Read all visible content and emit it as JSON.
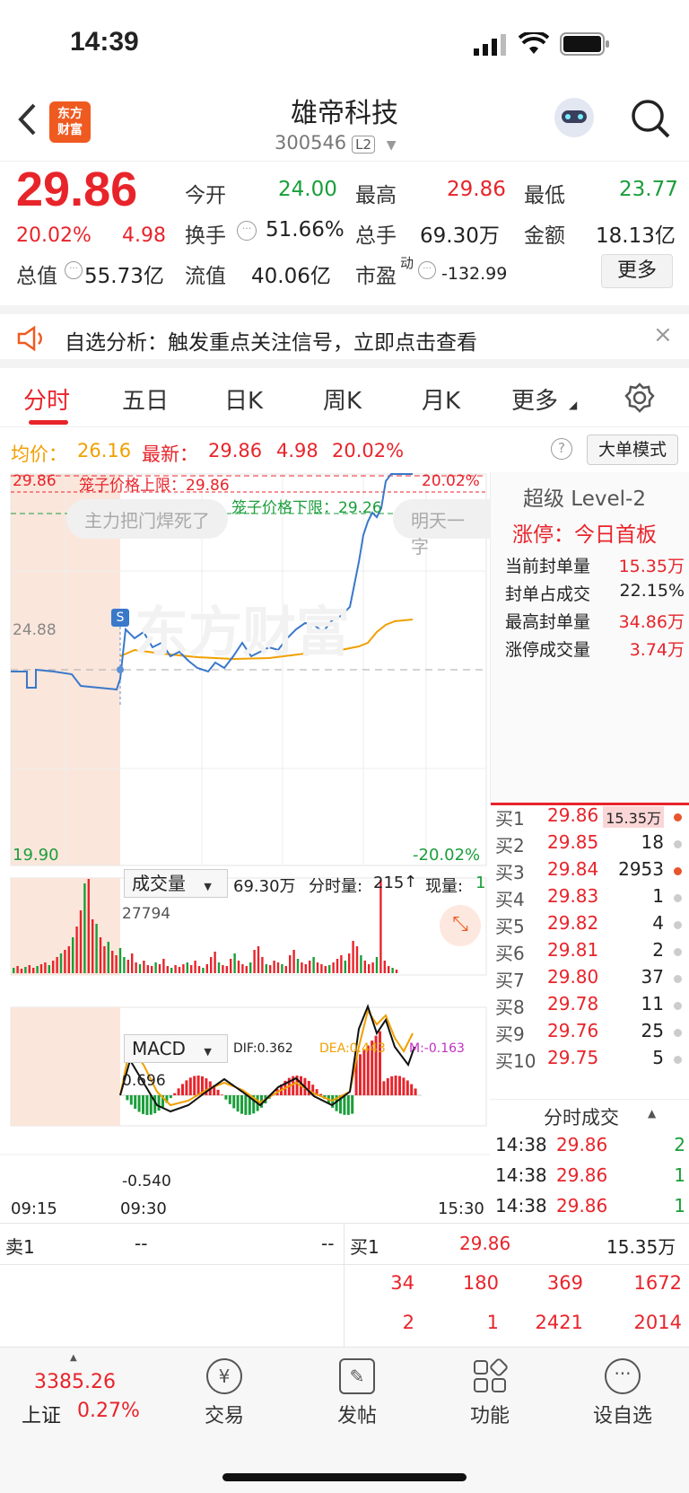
{
  "status_bar": {
    "time": "14:39"
  },
  "header": {
    "logo_line1": "东方",
    "logo_line2": "财富",
    "title": "雄帝科技",
    "code": "300546",
    "level": "L2"
  },
  "quote": {
    "price": "29.86",
    "pct": "20.02%",
    "change": "4.98",
    "open_label": "今开",
    "open": "24.00",
    "high_label": "最高",
    "high": "29.86",
    "low_label": "最低",
    "low": "23.77",
    "turnover_label": "换手",
    "turnover": "51.66%",
    "volume_label": "总手",
    "volume": "69.30万",
    "amount_label": "金额",
    "amount": "18.13亿",
    "mktcap_label": "总值",
    "mktcap": "55.73亿",
    "float_label": "流值",
    "float": "40.06亿",
    "pe_label": "市盈",
    "pe_sup": "动",
    "pe": "-132.99",
    "more_button": "更多"
  },
  "notice": {
    "text": "自选分析：触发重点关注信号，立即点击查看"
  },
  "tabs": [
    "分时",
    "五日",
    "日K",
    "周K",
    "月K",
    "更多"
  ],
  "chart_header": {
    "avg_label": "均价：",
    "avg": "26.16",
    "latest_label": "最新：",
    "latest": "29.86",
    "chg": "4.98",
    "pct": "20.02%",
    "mode_button": "大单模式"
  },
  "chart_labels": {
    "top_price": "29.86",
    "top_pct": "20.02%",
    "upper_cage": "笼子价格上限：29.86",
    "lower_cage": "笼子价格下限：29.26",
    "bottom_price": "19.90",
    "bottom_pct": "-20.02%",
    "mid_price": "24.88",
    "s_marker": "S",
    "bubble1": "主力把门焊死了",
    "bubble2": "明天一字",
    "watermark": "东方财富"
  },
  "volume_header": {
    "select": "成交量",
    "total": "69.30万",
    "minute_label": "分时量:",
    "minute": "215",
    "now_label": "现量:",
    "now": "1",
    "max": "27794"
  },
  "macd_header": {
    "select": "MACD",
    "dif": "DIF:0.362",
    "dea": "DEA:0.443",
    "m": "M:-0.163",
    "top": "0.696",
    "bottom": "-0.540"
  },
  "time_axis": [
    "09:15",
    "09:30",
    "15:30"
  ],
  "level2": {
    "title": "超级 Level-2",
    "limit_status": "涨停：今日首板",
    "rows": [
      {
        "label": "当前封单量",
        "value": "15.35万"
      },
      {
        "label": "封单占成交",
        "value": "22.15%"
      },
      {
        "label": "最高封单量",
        "value": "34.86万"
      },
      {
        "label": "涨停成交量",
        "value": "3.74万"
      }
    ]
  },
  "orderbook": [
    {
      "label": "买1",
      "price": "29.86",
      "vol": "15.35万",
      "dot": "#e8542b"
    },
    {
      "label": "买2",
      "price": "29.85",
      "vol": "18",
      "dot": "#cccccc"
    },
    {
      "label": "买3",
      "price": "29.84",
      "vol": "2953",
      "dot": "#e8542b"
    },
    {
      "label": "买4",
      "price": "29.83",
      "vol": "1",
      "dot": "#cccccc"
    },
    {
      "label": "买5",
      "price": "29.82",
      "vol": "4",
      "dot": "#cccccc"
    },
    {
      "label": "买6",
      "price": "29.81",
      "vol": "2",
      "dot": "#cccccc"
    },
    {
      "label": "买7",
      "price": "29.80",
      "vol": "37",
      "dot": "#cccccc"
    },
    {
      "label": "买8",
      "price": "29.78",
      "vol": "11",
      "dot": "#cccccc"
    },
    {
      "label": "买9",
      "price": "29.76",
      "vol": "25",
      "dot": "#cccccc"
    },
    {
      "label": "买10",
      "price": "29.75",
      "vol": "5",
      "dot": "#cccccc"
    }
  ],
  "ticks": {
    "title": "分时成交",
    "rows": [
      {
        "time": "14:38",
        "price": "29.86",
        "vol": "2"
      },
      {
        "time": "14:38",
        "price": "29.86",
        "vol": "1"
      },
      {
        "time": "14:38",
        "price": "29.86",
        "vol": "1"
      }
    ]
  },
  "bottom_book": {
    "sell_label": "卖1",
    "sell_price": "--",
    "sell_vol": "--",
    "buy_label": "买1",
    "buy_price": "29.86",
    "buy_vol": "15.35万",
    "row1": [
      "34",
      "180",
      "369",
      "1672"
    ],
    "row2": [
      "2",
      "1",
      "2421",
      "2014"
    ]
  },
  "bottom_nav": {
    "index_value": "3385.26",
    "index_name": "上证",
    "index_pct": "0.27%",
    "items": [
      "交易",
      "发帖",
      "功能",
      "设自选"
    ]
  }
}
